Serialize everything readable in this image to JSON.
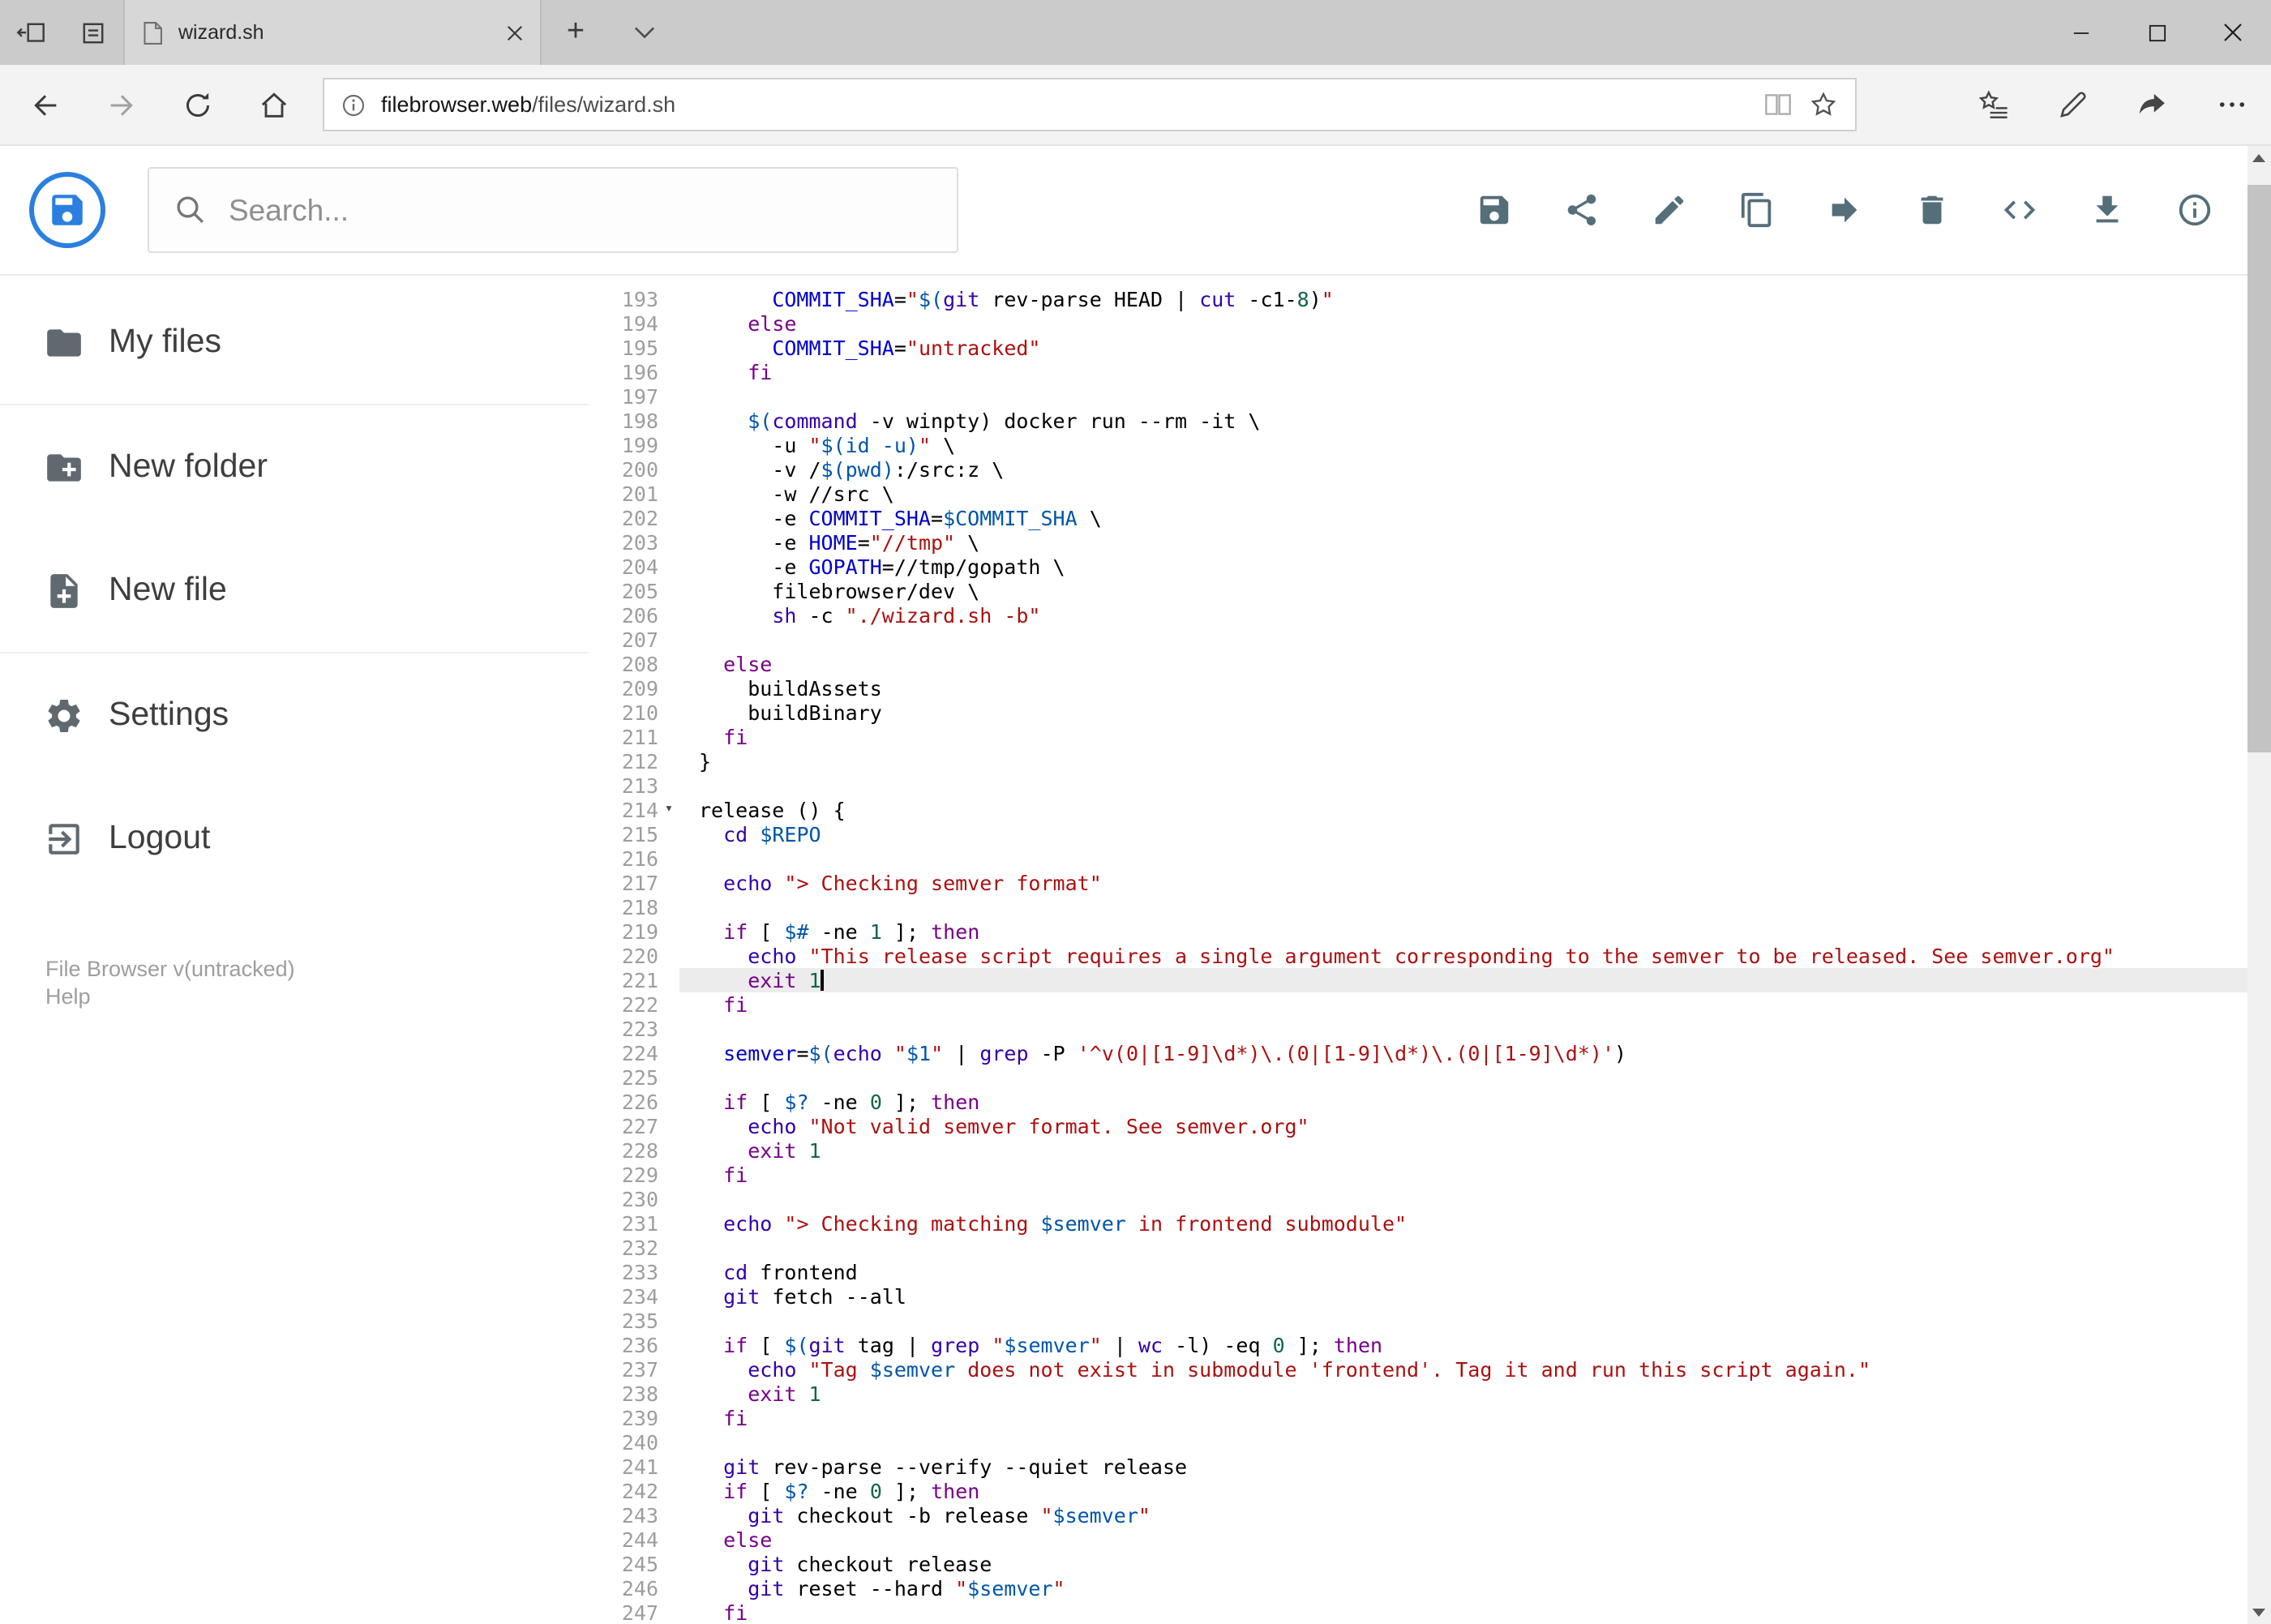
{
  "browser": {
    "tab_title": "wizard.sh",
    "new_tab_label": "+",
    "url_domain": "filebrowser.web",
    "url_path": "/files/wizard.sh",
    "window_controls": [
      "minimize",
      "maximize",
      "close"
    ],
    "nav_icons": [
      "back",
      "forward",
      "refresh",
      "home",
      "page-info",
      "reading-view",
      "favorite-star",
      "hub",
      "web-note",
      "share",
      "more-options"
    ]
  },
  "app": {
    "search_placeholder": "Search...",
    "toolbar_icons": [
      "save",
      "share",
      "edit",
      "copy",
      "move",
      "delete",
      "code",
      "download",
      "info"
    ],
    "sidebar": {
      "items": [
        {
          "label": "My files",
          "icon": "folder"
        },
        {
          "label": "New folder",
          "icon": "folder-plus"
        },
        {
          "label": "New file",
          "icon": "file-plus"
        },
        {
          "label": "Settings",
          "icon": "gear"
        },
        {
          "label": "Logout",
          "icon": "logout"
        }
      ],
      "footer_version": "File Browser v(untracked)",
      "footer_help": "Help"
    },
    "accent_color": "#2a7fe0",
    "icon_color": "#546e7a"
  },
  "editor": {
    "active_line": 221,
    "fold_line": 214,
    "fold_glyph": "▾",
    "lines": [
      {
        "n": 193,
        "t": [
          [
            "pl",
            "      "
          ],
          [
            "df",
            "COMMIT_SHA"
          ],
          [
            "pl",
            "="
          ],
          [
            "st",
            "\""
          ],
          [
            "vr",
            "$("
          ],
          [
            "bi",
            "git"
          ],
          [
            "pl",
            " rev-parse HEAD | "
          ],
          [
            "bi",
            "cut"
          ],
          [
            "pl",
            " -c1-"
          ],
          [
            "nu",
            "8"
          ],
          [
            "pl",
            ")"
          ],
          [
            "st",
            "\""
          ]
        ]
      },
      {
        "n": 194,
        "t": [
          [
            "pl",
            "    "
          ],
          [
            "kw",
            "else"
          ]
        ]
      },
      {
        "n": 195,
        "t": [
          [
            "pl",
            "      "
          ],
          [
            "df",
            "COMMIT_SHA"
          ],
          [
            "pl",
            "="
          ],
          [
            "st",
            "\"untracked\""
          ]
        ]
      },
      {
        "n": 196,
        "t": [
          [
            "pl",
            "    "
          ],
          [
            "kw",
            "fi"
          ]
        ]
      },
      {
        "n": 197,
        "t": []
      },
      {
        "n": 198,
        "t": [
          [
            "pl",
            "    "
          ],
          [
            "vr",
            "$("
          ],
          [
            "bi",
            "command"
          ],
          [
            "pl",
            " -v winpty) docker run --rm -it \\"
          ]
        ]
      },
      {
        "n": 199,
        "t": [
          [
            "pl",
            "      -u "
          ],
          [
            "st",
            "\""
          ],
          [
            "vr",
            "$(id -u)"
          ],
          [
            "st",
            "\""
          ],
          [
            "pl",
            " \\"
          ]
        ]
      },
      {
        "n": 200,
        "t": [
          [
            "pl",
            "      -v /"
          ],
          [
            "vr",
            "$(pwd)"
          ],
          [
            "pl",
            ":/src:z \\"
          ]
        ]
      },
      {
        "n": 201,
        "t": [
          [
            "pl",
            "      -w //src \\"
          ]
        ]
      },
      {
        "n": 202,
        "t": [
          [
            "pl",
            "      -e "
          ],
          [
            "df",
            "COMMIT_SHA"
          ],
          [
            "pl",
            "="
          ],
          [
            "vr",
            "$COMMIT_SHA"
          ],
          [
            "pl",
            " \\"
          ]
        ]
      },
      {
        "n": 203,
        "t": [
          [
            "pl",
            "      -e "
          ],
          [
            "df",
            "HOME"
          ],
          [
            "pl",
            "="
          ],
          [
            "st",
            "\"//tmp\""
          ],
          [
            "pl",
            " \\"
          ]
        ]
      },
      {
        "n": 204,
        "t": [
          [
            "pl",
            "      -e "
          ],
          [
            "df",
            "GOPATH"
          ],
          [
            "pl",
            "=//tmp/gopath \\"
          ]
        ]
      },
      {
        "n": 205,
        "t": [
          [
            "pl",
            "      filebrowser/dev \\"
          ]
        ]
      },
      {
        "n": 206,
        "t": [
          [
            "pl",
            "      "
          ],
          [
            "bi",
            "sh"
          ],
          [
            "pl",
            " -c "
          ],
          [
            "st",
            "\"./wizard.sh -b\""
          ]
        ]
      },
      {
        "n": 207,
        "t": []
      },
      {
        "n": 208,
        "t": [
          [
            "pl",
            "  "
          ],
          [
            "kw",
            "else"
          ]
        ]
      },
      {
        "n": 209,
        "t": [
          [
            "pl",
            "    buildAssets"
          ]
        ]
      },
      {
        "n": 210,
        "t": [
          [
            "pl",
            "    buildBinary"
          ]
        ]
      },
      {
        "n": 211,
        "t": [
          [
            "pl",
            "  "
          ],
          [
            "kw",
            "fi"
          ]
        ]
      },
      {
        "n": 212,
        "t": [
          [
            "pl",
            "}"
          ]
        ]
      },
      {
        "n": 213,
        "t": []
      },
      {
        "n": 214,
        "t": [
          [
            "pl",
            "release () {"
          ]
        ]
      },
      {
        "n": 215,
        "t": [
          [
            "pl",
            "  "
          ],
          [
            "bi",
            "cd"
          ],
          [
            "pl",
            " "
          ],
          [
            "vr",
            "$REPO"
          ]
        ]
      },
      {
        "n": 216,
        "t": []
      },
      {
        "n": 217,
        "t": [
          [
            "pl",
            "  "
          ],
          [
            "bi",
            "echo"
          ],
          [
            "pl",
            " "
          ],
          [
            "st",
            "\"> Checking semver format\""
          ]
        ]
      },
      {
        "n": 218,
        "t": []
      },
      {
        "n": 219,
        "t": [
          [
            "pl",
            "  "
          ],
          [
            "kw",
            "if"
          ],
          [
            "pl",
            " [ "
          ],
          [
            "vr",
            "$#"
          ],
          [
            "pl",
            " -ne "
          ],
          [
            "nu",
            "1"
          ],
          [
            "pl",
            " ]; "
          ],
          [
            "kw",
            "then"
          ]
        ]
      },
      {
        "n": 220,
        "t": [
          [
            "pl",
            "    "
          ],
          [
            "bi",
            "echo"
          ],
          [
            "pl",
            " "
          ],
          [
            "st",
            "\"This release script requires a single argument corresponding to the semver to be released. See semver.org\""
          ]
        ]
      },
      {
        "n": 221,
        "t": [
          [
            "pl",
            "    "
          ],
          [
            "kw",
            "exit"
          ],
          [
            "pl",
            " "
          ],
          [
            "nu",
            "1"
          ]
        ]
      },
      {
        "n": 222,
        "t": [
          [
            "pl",
            "  "
          ],
          [
            "kw",
            "fi"
          ]
        ]
      },
      {
        "n": 223,
        "t": []
      },
      {
        "n": 224,
        "t": [
          [
            "pl",
            "  "
          ],
          [
            "df",
            "semver"
          ],
          [
            "pl",
            "="
          ],
          [
            "vr",
            "$("
          ],
          [
            "bi",
            "echo"
          ],
          [
            "pl",
            " "
          ],
          [
            "st",
            "\""
          ],
          [
            "vr",
            "$1"
          ],
          [
            "st",
            "\""
          ],
          [
            "pl",
            " | "
          ],
          [
            "bi",
            "grep"
          ],
          [
            "pl",
            " -P "
          ],
          [
            "st",
            "'^v(0|[1-9]\\d*)\\.(0|[1-9]\\d*)\\.(0|[1-9]\\d*)'"
          ],
          [
            "pl",
            ")"
          ]
        ]
      },
      {
        "n": 225,
        "t": []
      },
      {
        "n": 226,
        "t": [
          [
            "pl",
            "  "
          ],
          [
            "kw",
            "if"
          ],
          [
            "pl",
            " [ "
          ],
          [
            "vr",
            "$?"
          ],
          [
            "pl",
            " -ne "
          ],
          [
            "nu",
            "0"
          ],
          [
            "pl",
            " ]; "
          ],
          [
            "kw",
            "then"
          ]
        ]
      },
      {
        "n": 227,
        "t": [
          [
            "pl",
            "    "
          ],
          [
            "bi",
            "echo"
          ],
          [
            "pl",
            " "
          ],
          [
            "st",
            "\"Not valid semver format. See semver.org\""
          ]
        ]
      },
      {
        "n": 228,
        "t": [
          [
            "pl",
            "    "
          ],
          [
            "kw",
            "exit"
          ],
          [
            "pl",
            " "
          ],
          [
            "nu",
            "1"
          ]
        ]
      },
      {
        "n": 229,
        "t": [
          [
            "pl",
            "  "
          ],
          [
            "kw",
            "fi"
          ]
        ]
      },
      {
        "n": 230,
        "t": []
      },
      {
        "n": 231,
        "t": [
          [
            "pl",
            "  "
          ],
          [
            "bi",
            "echo"
          ],
          [
            "pl",
            " "
          ],
          [
            "st",
            "\"> Checking matching "
          ],
          [
            "vr",
            "$semver"
          ],
          [
            "st",
            " in frontend submodule\""
          ]
        ]
      },
      {
        "n": 232,
        "t": []
      },
      {
        "n": 233,
        "t": [
          [
            "pl",
            "  "
          ],
          [
            "bi",
            "cd"
          ],
          [
            "pl",
            " frontend"
          ]
        ]
      },
      {
        "n": 234,
        "t": [
          [
            "pl",
            "  "
          ],
          [
            "bi",
            "git"
          ],
          [
            "pl",
            " fetch --all"
          ]
        ]
      },
      {
        "n": 235,
        "t": []
      },
      {
        "n": 236,
        "t": [
          [
            "pl",
            "  "
          ],
          [
            "kw",
            "if"
          ],
          [
            "pl",
            " [ "
          ],
          [
            "vr",
            "$("
          ],
          [
            "bi",
            "git"
          ],
          [
            "pl",
            " tag | "
          ],
          [
            "bi",
            "grep"
          ],
          [
            "pl",
            " "
          ],
          [
            "st",
            "\""
          ],
          [
            "vr",
            "$semver"
          ],
          [
            "st",
            "\""
          ],
          [
            "pl",
            " | "
          ],
          [
            "bi",
            "wc"
          ],
          [
            "pl",
            " -l) -eq "
          ],
          [
            "nu",
            "0"
          ],
          [
            "pl",
            " ]; "
          ],
          [
            "kw",
            "then"
          ]
        ]
      },
      {
        "n": 237,
        "t": [
          [
            "pl",
            "    "
          ],
          [
            "bi",
            "echo"
          ],
          [
            "pl",
            " "
          ],
          [
            "st",
            "\"Tag "
          ],
          [
            "vr",
            "$semver"
          ],
          [
            "st",
            " does not exist in submodule 'frontend'. Tag it and run this script again.\""
          ]
        ]
      },
      {
        "n": 238,
        "t": [
          [
            "pl",
            "    "
          ],
          [
            "kw",
            "exit"
          ],
          [
            "pl",
            " "
          ],
          [
            "nu",
            "1"
          ]
        ]
      },
      {
        "n": 239,
        "t": [
          [
            "pl",
            "  "
          ],
          [
            "kw",
            "fi"
          ]
        ]
      },
      {
        "n": 240,
        "t": []
      },
      {
        "n": 241,
        "t": [
          [
            "pl",
            "  "
          ],
          [
            "bi",
            "git"
          ],
          [
            "pl",
            " rev-parse --verify --quiet release"
          ]
        ]
      },
      {
        "n": 242,
        "t": [
          [
            "pl",
            "  "
          ],
          [
            "kw",
            "if"
          ],
          [
            "pl",
            " [ "
          ],
          [
            "vr",
            "$?"
          ],
          [
            "pl",
            " -ne "
          ],
          [
            "nu",
            "0"
          ],
          [
            "pl",
            " ]; "
          ],
          [
            "kw",
            "then"
          ]
        ]
      },
      {
        "n": 243,
        "t": [
          [
            "pl",
            "    "
          ],
          [
            "bi",
            "git"
          ],
          [
            "pl",
            " checkout -b release "
          ],
          [
            "st",
            "\""
          ],
          [
            "vr",
            "$semver"
          ],
          [
            "st",
            "\""
          ]
        ]
      },
      {
        "n": 244,
        "t": [
          [
            "pl",
            "  "
          ],
          [
            "kw",
            "else"
          ]
        ]
      },
      {
        "n": 245,
        "t": [
          [
            "pl",
            "    "
          ],
          [
            "bi",
            "git"
          ],
          [
            "pl",
            " checkout release"
          ]
        ]
      },
      {
        "n": 246,
        "t": [
          [
            "pl",
            "    "
          ],
          [
            "bi",
            "git"
          ],
          [
            "pl",
            " reset --hard "
          ],
          [
            "st",
            "\""
          ],
          [
            "vr",
            "$semver"
          ],
          [
            "st",
            "\""
          ]
        ]
      },
      {
        "n": 247,
        "t": [
          [
            "pl",
            "  "
          ],
          [
            "kw",
            "fi"
          ]
        ]
      }
    ]
  }
}
